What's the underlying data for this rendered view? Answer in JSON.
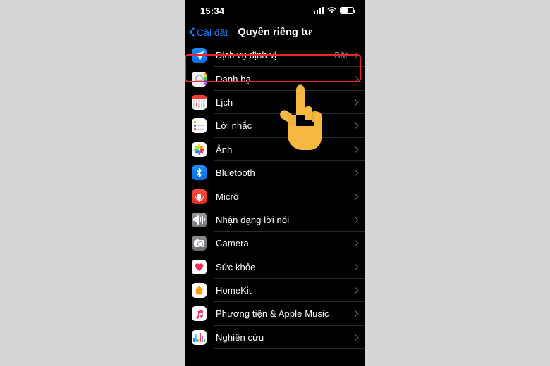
{
  "status_bar": {
    "time": "15:34",
    "icons": [
      "cellular-signal-icon",
      "wifi-icon",
      "battery-icon"
    ],
    "battery_level": 55
  },
  "nav_bar": {
    "back_label": "Cài đặt",
    "title": "Quyền riêng tư"
  },
  "colors": {
    "screen_background": "#000000",
    "page_background": "#d6d6d6",
    "accent_blue": "#0a84ff",
    "highlight_red": "#f0252a",
    "separator": "#2a2a2c",
    "secondary_text": "#8e8e93"
  },
  "highlight": {
    "target_row": "Dịch vụ định vị",
    "color": "#f0252a"
  },
  "cursor": {
    "type": "pointing-hand",
    "color": "#f5b942"
  },
  "list": {
    "rows": [
      {
        "label": "Dịch vụ định vị",
        "value": "Bật",
        "icon": "location-services-icon"
      },
      {
        "label": "Danh bạ",
        "value": "",
        "icon": "contacts-icon"
      },
      {
        "label": "Lịch",
        "value": "",
        "icon": "calendar-icon"
      },
      {
        "label": "Lời nhắc",
        "value": "",
        "icon": "reminders-icon"
      },
      {
        "label": "Ảnh",
        "value": "",
        "icon": "photos-icon"
      },
      {
        "label": "Bluetooth",
        "value": "",
        "icon": "bluetooth-icon"
      },
      {
        "label": "Micrô",
        "value": "",
        "icon": "microphone-icon"
      },
      {
        "label": "Nhận dạng lời nói",
        "value": "",
        "icon": "speech-recognition-icon"
      },
      {
        "label": "Camera",
        "value": "",
        "icon": "camera-icon"
      },
      {
        "label": "Sức khỏe",
        "value": "",
        "icon": "health-icon"
      },
      {
        "label": "HomeKit",
        "value": "",
        "icon": "homekit-icon"
      },
      {
        "label": "Phương tiện & Apple Music",
        "value": "",
        "icon": "apple-music-icon"
      },
      {
        "label": "Nghiên cứu",
        "value": "",
        "icon": "research-icon"
      }
    ]
  }
}
